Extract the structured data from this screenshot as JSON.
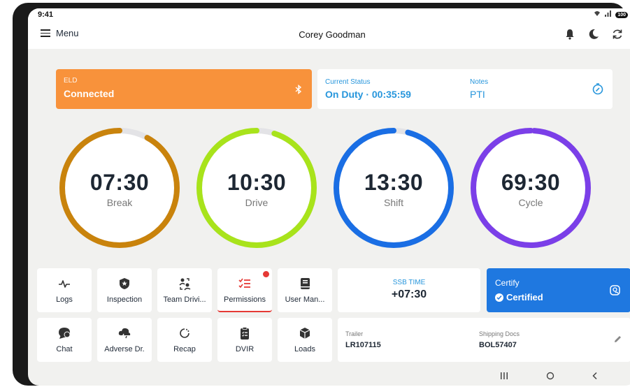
{
  "status_bar": {
    "time": "9:41",
    "battery": "100"
  },
  "app_bar": {
    "menu_label": "Menu",
    "driver_name": "Corey Goodman"
  },
  "eld": {
    "label": "ELD",
    "value": "Connected"
  },
  "current_status": {
    "label": "Current Status",
    "value": "On Duty · 00:35:59"
  },
  "notes": {
    "label": "Notes",
    "value": "PTI"
  },
  "gauges": [
    {
      "value": "07:30",
      "label": "Break",
      "color": "#c9830c",
      "progress": 0.92
    },
    {
      "value": "10:30",
      "label": "Drive",
      "color": "#a8e31b",
      "progress": 0.95
    },
    {
      "value": "13:30",
      "label": "Shift",
      "color": "#1a6ee4",
      "progress": 0.96
    },
    {
      "value": "69:30",
      "label": "Cycle",
      "color": "#7b3fe8",
      "progress": 0.99
    }
  ],
  "gauge_track_color": "#e3e3e6",
  "tiles_row1": [
    {
      "label": "Logs",
      "icon": "pulse-icon"
    },
    {
      "label": "Inspection",
      "icon": "shield-badge-icon"
    },
    {
      "label": "Team Drivi...",
      "icon": "team-icon"
    },
    {
      "label": "Permissions",
      "icon": "checklist-icon"
    },
    {
      "label": "User Man...",
      "icon": "book-icon"
    }
  ],
  "tiles_row2": [
    {
      "label": "Chat",
      "icon": "chat-icon"
    },
    {
      "label": "Adverse Dr.",
      "icon": "storm-cloud-icon"
    },
    {
      "label": "Recap",
      "icon": "recap-icon"
    },
    {
      "label": "DVIR",
      "icon": "clipboard-icon"
    },
    {
      "label": "Loads",
      "icon": "box-icon"
    }
  ],
  "ssb": {
    "label": "SSB TIME",
    "value": "+07:30"
  },
  "certify": {
    "label": "Certify",
    "status": "Certified"
  },
  "docs": {
    "trailer_label": "Trailer",
    "trailer_value": "LR107115",
    "shipping_label": "Shipping Docs",
    "shipping_value": "BOL57407"
  },
  "colors": {
    "eld_orange": "#f8923b",
    "status_blue": "#2796dc",
    "certify_blue": "#1f78e0",
    "alert_red": "#e53935"
  }
}
